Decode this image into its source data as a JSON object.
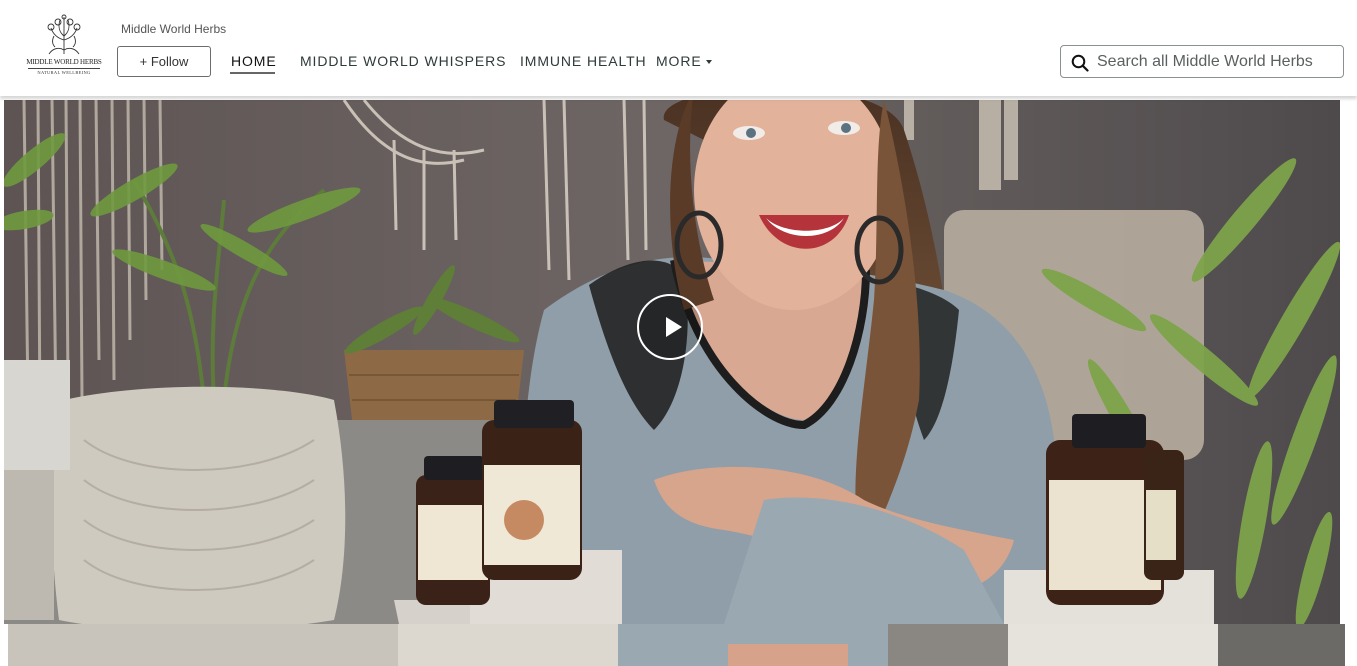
{
  "brand": {
    "logo_name": "MIDDLE WORLD HERBS",
    "logo_tagline": "NATURAL WELLBEING",
    "store_name": "Middle World Herbs",
    "follow_label": "+ Follow"
  },
  "nav": {
    "items": [
      {
        "label": "HOME",
        "active": true
      },
      {
        "label": "MIDDLE WORLD WHISPERS",
        "active": false
      },
      {
        "label": "IMMUNE HEALTH",
        "active": false
      },
      {
        "label": "MORE",
        "active": false,
        "has_dropdown": true
      }
    ]
  },
  "search": {
    "placeholder": "Search all Middle World Herbs",
    "icon": "search-icon"
  },
  "hero": {
    "type": "video",
    "play_icon": "play-icon"
  },
  "colors": {
    "header_bg": "#ffffff",
    "text": "#2f3a3a",
    "border": "#6c6c6c"
  }
}
